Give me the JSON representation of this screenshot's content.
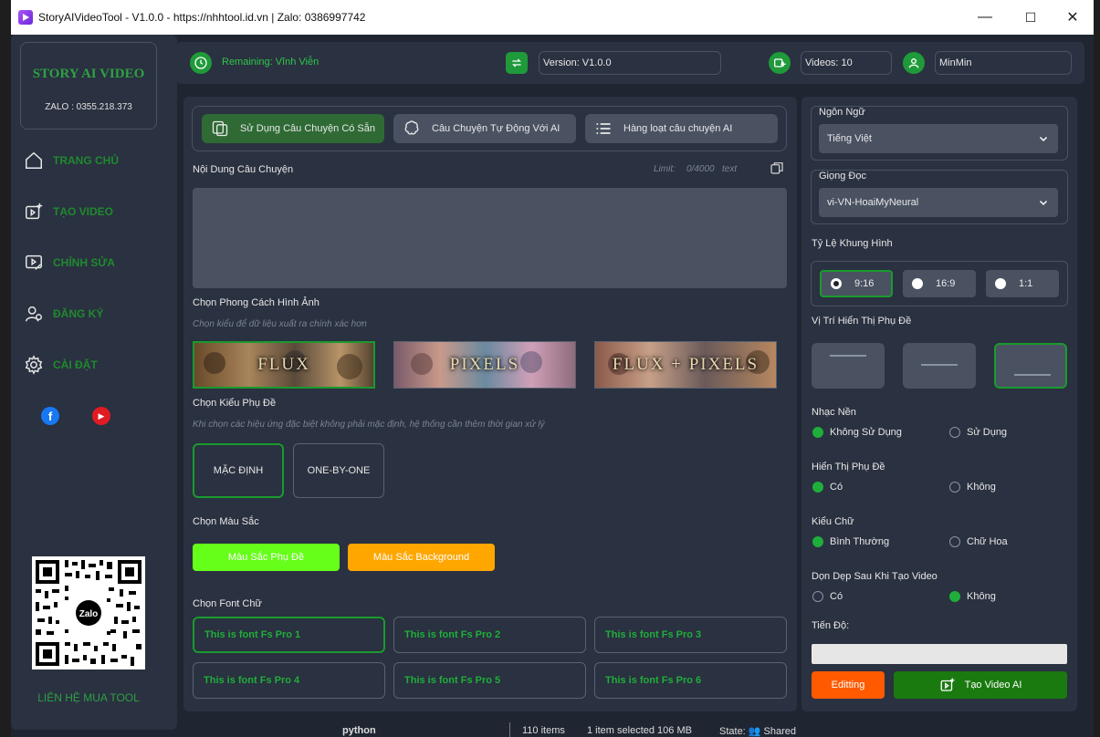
{
  "window": {
    "title": "StoryAIVideoTool  -  V1.0.0  -  https://nhhtool.id.vn | Zalo: 0386997742",
    "minimize": "—",
    "maximize": "☐",
    "close": "✕"
  },
  "sidebar": {
    "logo_title": "STORY AI VIDEO",
    "logo_zalo": "ZALO : 0355.218.373",
    "items": [
      {
        "label": "TRANG CHỦ",
        "icon": "home-icon"
      },
      {
        "label": "TẠO VIDEO",
        "icon": "video-add-icon"
      },
      {
        "label": "CHỈNH SỬA",
        "icon": "edit-video-icon"
      },
      {
        "label": "ĐĂNG KÝ",
        "icon": "user-register-icon"
      },
      {
        "label": "CÀI ĐẶT",
        "icon": "gear-icon"
      }
    ],
    "social": {
      "facebook": "f",
      "youtube": "▶"
    },
    "qr_logo": "Zalo",
    "contact": "LIÊN HỆ MUA TOOL"
  },
  "topbar": {
    "remaining": "Remaining: Vĩnh Viễn",
    "version": "Version: V1.0.0",
    "videos": "Videos: 10",
    "username": "MinMin"
  },
  "main": {
    "tabs": [
      {
        "label": "Sử Dụng Câu Chuyện Có Sẵn",
        "active": true
      },
      {
        "label": "Câu Chuyện Tự Động Với AI",
        "active": false
      },
      {
        "label": "Hàng loạt câu chuyện AI",
        "active": false
      }
    ],
    "story_label": "Nội Dung Câu Chuyện",
    "limit_label": "Limit:",
    "limit_value": "0/4000",
    "limit_unit": "text",
    "story_value": "",
    "style_label": "Chọn Phong Cách Hình Ảnh",
    "style_hint": "Chọn kiểu để dữ liệu xuất ra chính xác hơn",
    "styles": [
      "FLUX",
      "PIXELS",
      "FLUX + PIXELS"
    ],
    "subtitle_label": "Chọn Kiểu Phụ Đề",
    "subtitle_hint": "Khi chọn các hiệu ứng đặc biệt không phải mặc định, hệ thống cần thêm thời gian xử lý",
    "subtitle_styles": [
      "MẶC ĐỊNH",
      "ONE-BY-ONE"
    ],
    "color_label": "Chọn Màu Sắc",
    "color_subtitle": "Màu Sắc Phụ Đề",
    "color_background": "Màu Sắc Background",
    "font_label": "Chọn Font Chữ",
    "fonts": [
      "This is font Fs Pro 1",
      "This is font Fs Pro 2",
      "This is font Fs Pro 3",
      "This is font Fs Pro 4",
      "This is font Fs Pro 5",
      "This is font Fs Pro 6"
    ]
  },
  "right": {
    "language_label": "Ngôn Ngữ",
    "language_value": "Tiếng Việt",
    "voice_label": "Giọng Đọc",
    "voice_value": "vi-VN-HoaiMyNeural",
    "ratio_label": "Tỷ Lệ Khung Hình",
    "ratios": [
      "9:16",
      "16:9",
      "1:1"
    ],
    "subpos_label": "Vị Trí Hiển Thị Phụ Đề",
    "music_label": "Nhạc Nền",
    "music_options": [
      "Không Sử Dụng",
      "Sử Dụng"
    ],
    "showsub_label": "Hiển Thị Phụ Đề",
    "showsub_options": [
      "Có",
      "Không"
    ],
    "case_label": "Kiểu Chữ",
    "case_options": [
      "Bình Thường",
      "Chữ Hoa"
    ],
    "cleanup_label": "Dọn Dẹp Sau Khi Tạo Video",
    "cleanup_options": [
      "Có",
      "Không"
    ],
    "progress_label": "Tiến Độ:",
    "progress_value": 0,
    "editing_button": "Editting",
    "create_button": "Tạo Video AI"
  },
  "background_taskbar": {
    "folder": "python",
    "items": "110 items",
    "selected": "1 item selected  106 MB",
    "state": "State: 👥 Shared"
  },
  "colors": {
    "accent_green": "#1f9a3a",
    "subtitle_color": "#66ff1a",
    "background_color": "#ffa600",
    "editing": "#ff5a00",
    "create": "#1a7a10"
  }
}
